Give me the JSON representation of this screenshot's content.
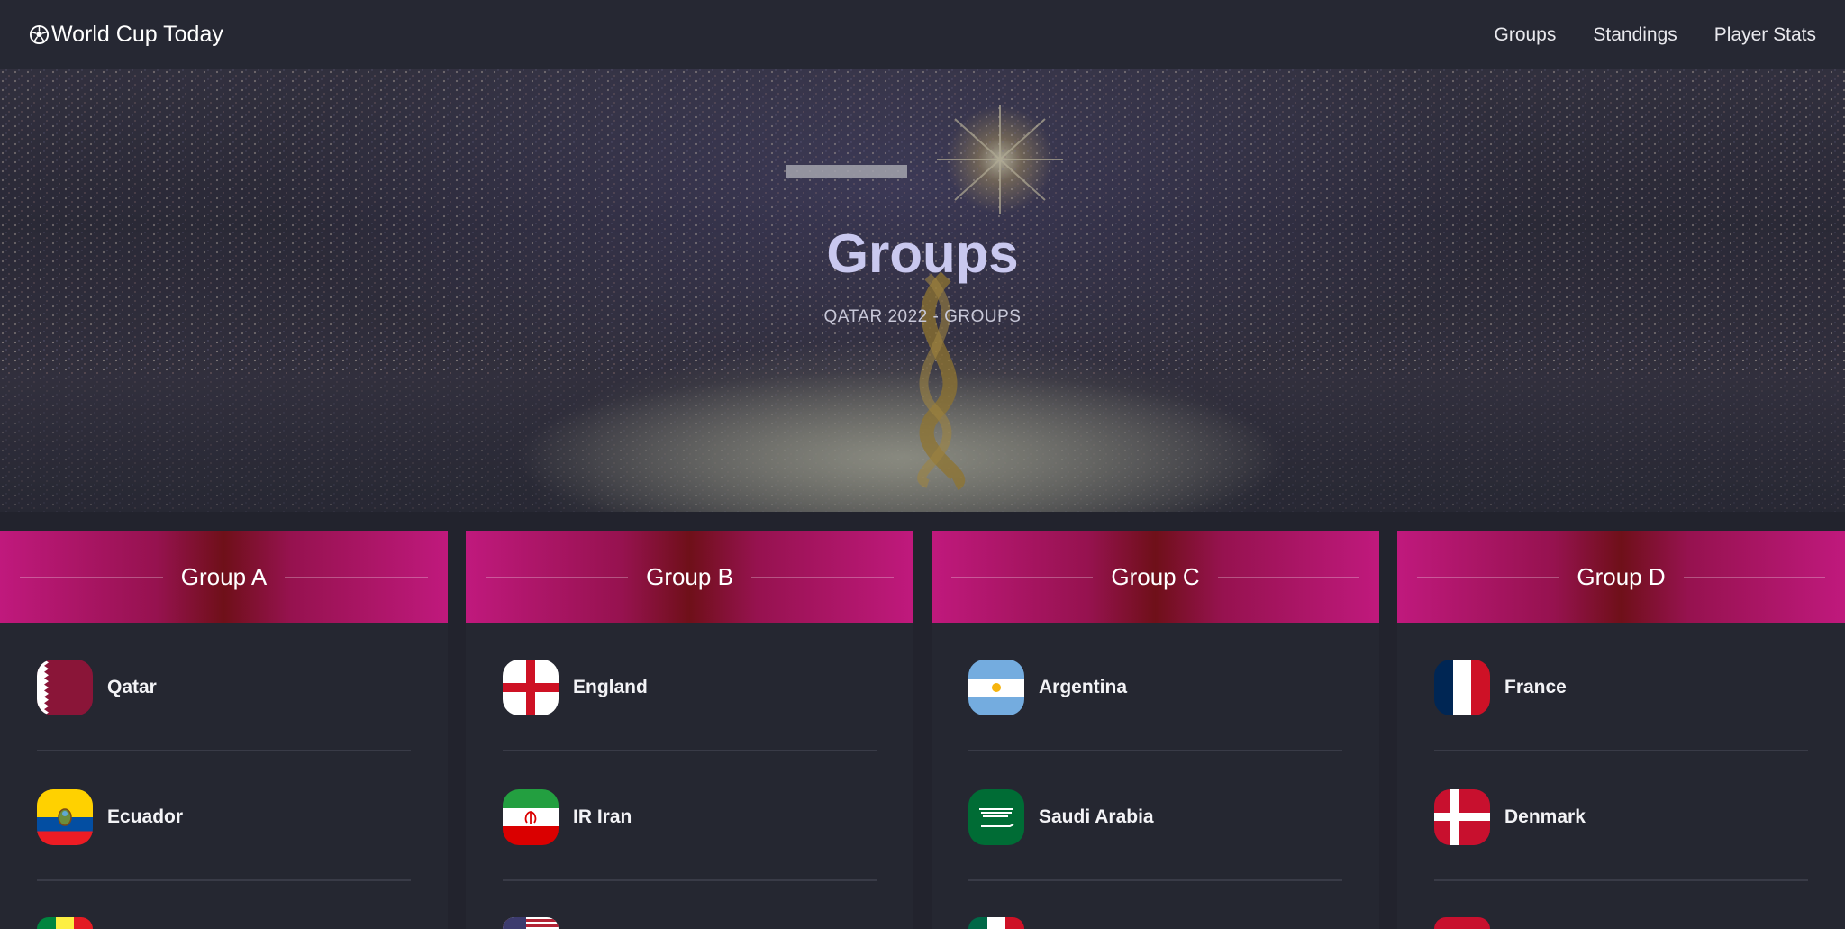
{
  "nav": {
    "brand": "World Cup Today",
    "links": [
      "Groups",
      "Standings",
      "Player Stats"
    ]
  },
  "hero": {
    "title": "Groups",
    "subtitle": "QATAR 2022 - GROUPS"
  },
  "colors": {
    "header_gradient_edge": "#c0197d",
    "header_gradient_center": "#6f1019",
    "background": "#22232d",
    "panel": "#252731"
  },
  "groups": [
    {
      "title": "Group A",
      "teams": [
        {
          "name": "Qatar",
          "flag": "qatar-flag-icon"
        },
        {
          "name": "Ecuador",
          "flag": "ecuador-flag-icon"
        }
      ]
    },
    {
      "title": "Group B",
      "teams": [
        {
          "name": "England",
          "flag": "england-flag-icon"
        },
        {
          "name": "IR Iran",
          "flag": "iran-flag-icon"
        }
      ]
    },
    {
      "title": "Group C",
      "teams": [
        {
          "name": "Argentina",
          "flag": "argentina-flag-icon"
        },
        {
          "name": "Saudi Arabia",
          "flag": "saudi-arabia-flag-icon"
        }
      ]
    },
    {
      "title": "Group D",
      "teams": [
        {
          "name": "France",
          "flag": "france-flag-icon"
        },
        {
          "name": "Denmark",
          "flag": "denmark-flag-icon"
        }
      ]
    }
  ]
}
